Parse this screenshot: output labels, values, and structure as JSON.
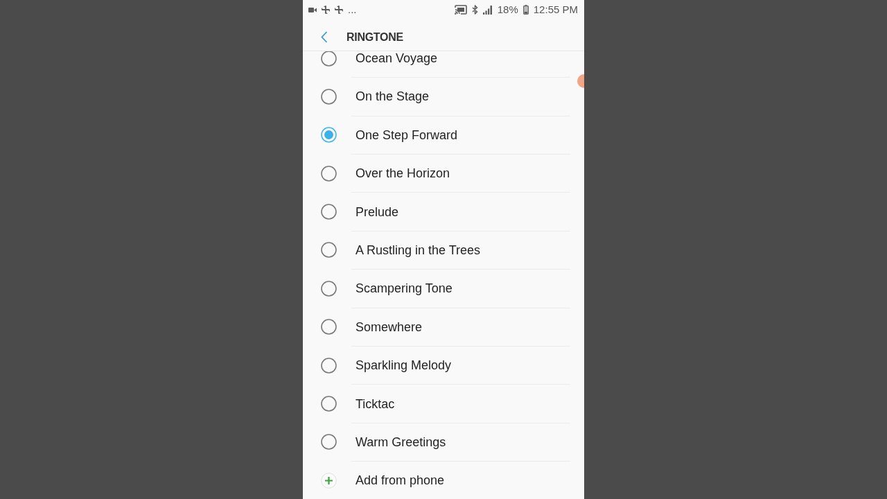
{
  "status_bar": {
    "overflow": "...",
    "battery": "18%",
    "time": "12:55 PM"
  },
  "header": {
    "title": "RINGTONE"
  },
  "ringtones": [
    {
      "label": "Ocean Voyage",
      "selected": false
    },
    {
      "label": "On the Stage",
      "selected": false
    },
    {
      "label": "One Step Forward",
      "selected": true
    },
    {
      "label": "Over the Horizon",
      "selected": false
    },
    {
      "label": "Prelude",
      "selected": false
    },
    {
      "label": "A Rustling in the Trees",
      "selected": false
    },
    {
      "label": "Scampering Tone",
      "selected": false
    },
    {
      "label": "Somewhere",
      "selected": false
    },
    {
      "label": "Sparkling Melody",
      "selected": false
    },
    {
      "label": "Ticktac",
      "selected": false
    },
    {
      "label": "Warm Greetings",
      "selected": false
    }
  ],
  "add_action": {
    "label": "Add from phone"
  }
}
